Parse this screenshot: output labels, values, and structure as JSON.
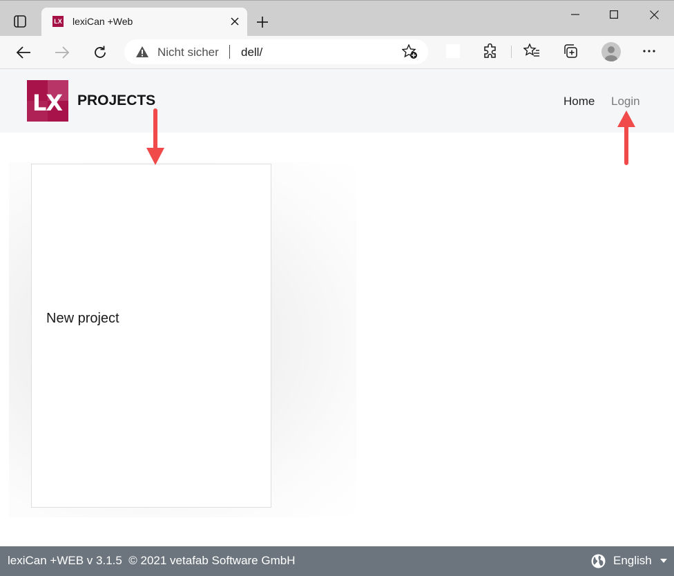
{
  "browser": {
    "tab_title": "lexiCan +Web",
    "favicon_text": "LX",
    "address": {
      "security_label": "Nicht sicher",
      "url": "dell/"
    }
  },
  "site": {
    "logo_text": "LX",
    "brand": "PROJECTS",
    "nav": {
      "home": "Home",
      "login": "Login"
    },
    "accent_color": "#a8134a"
  },
  "main": {
    "cards": [
      {
        "label": "New project"
      }
    ]
  },
  "footer": {
    "text": "lexiCan +WEB v 3.1.5  © 2021 vetafab Software GmbH",
    "language": "English",
    "background_color": "#6c757d"
  },
  "annotations": {
    "arrow_color": "#f04a4a"
  }
}
